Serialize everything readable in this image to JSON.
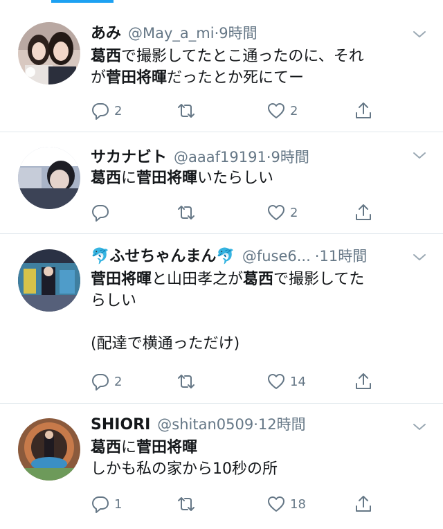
{
  "tweets": [
    {
      "name": "あみ",
      "handle": "@May_a_mi",
      "dot": "·",
      "time": "9時間",
      "lines": [
        [
          {
            "t": "葛西",
            "b": true
          },
          {
            "t": "で撮影してたとこ通ったのに、それ",
            "b": false
          }
        ],
        [
          {
            "t": "が",
            "b": false
          },
          {
            "t": "菅田将暉",
            "b": true
          },
          {
            "t": "だったとか死にてー",
            "b": false
          }
        ]
      ],
      "reply_count": "2",
      "retweet_count": "",
      "like_count": "2"
    },
    {
      "name": "サカナビト",
      "handle": "@aaaf19191",
      "dot": "·",
      "time": "9時間",
      "lines": [
        [
          {
            "t": "葛西",
            "b": true
          },
          {
            "t": "に",
            "b": false
          },
          {
            "t": "菅田将暉",
            "b": true
          },
          {
            "t": "いたらしい",
            "b": false
          }
        ]
      ],
      "reply_count": "",
      "retweet_count": "",
      "like_count": "2"
    },
    {
      "name": "ふせちゃんまん",
      "name_emoji": "🐬",
      "handle": "@fuse6...",
      "dot": "·",
      "time": "11時間",
      "lines": [
        [
          {
            "t": "菅田将暉",
            "b": true
          },
          {
            "t": "と山田孝之が",
            "b": false
          },
          {
            "t": "葛西",
            "b": true
          },
          {
            "t": "で撮影してた",
            "b": false
          }
        ],
        [
          {
            "t": "らしい",
            "b": false
          }
        ],
        [],
        [
          {
            "t": "(配達で横通っただけ)",
            "b": false
          }
        ]
      ],
      "reply_count": "2",
      "retweet_count": "",
      "like_count": "14"
    },
    {
      "name": "SHIORI",
      "handle": "@shitan0509",
      "dot": "·",
      "time": "12時間",
      "lines": [
        [
          {
            "t": "葛西",
            "b": true
          },
          {
            "t": "に",
            "b": false
          },
          {
            "t": "菅田将暉",
            "b": true
          }
        ],
        [
          {
            "t": "しかも私の家から10秒の所",
            "b": false
          }
        ]
      ],
      "reply_count": "1",
      "retweet_count": "",
      "like_count": "18"
    }
  ],
  "icons": {
    "reply": "reply-icon",
    "retweet": "retweet-icon",
    "like": "heart-icon",
    "share": "share-icon",
    "caret": "chevron-down-icon"
  },
  "colors": {
    "accent": "#1da1f2",
    "text": "#14171a",
    "muted": "#657786",
    "divider": "#e1e8ed"
  }
}
